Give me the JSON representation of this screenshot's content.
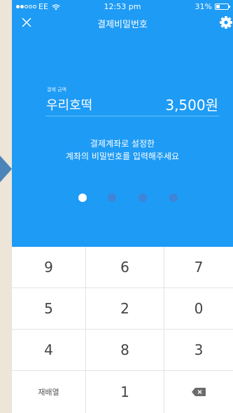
{
  "status_bar": {
    "carrier": "EE",
    "time": "12:53 pm",
    "battery": "31%",
    "signal_bars_filled": 2,
    "signal_bars_total": 5
  },
  "nav": {
    "title": "결제비밀번호",
    "close_icon": "close-icon",
    "settings_icon": "gear-icon"
  },
  "payment": {
    "amount_label": "결제 금액",
    "store_name": "우리호떡",
    "amount": "3,500원"
  },
  "instruction": {
    "line1": "결제계좌로 설정한",
    "line2": "계좌의 비밀번호를 입력해주세요"
  },
  "pin": {
    "total": 4,
    "filled": 1
  },
  "keypad": {
    "rows": [
      [
        "9",
        "6",
        "7"
      ],
      [
        "5",
        "2",
        "0"
      ],
      [
        "4",
        "8",
        "3"
      ],
      [
        "재배열",
        "1",
        "backspace"
      ]
    ],
    "backspace_icon": "backspace-icon"
  },
  "colors": {
    "primary_blue": "#1e9bf5",
    "empty_dot": "#3f84d6",
    "filled_dot": "#ffffff",
    "background": "#ece5d8",
    "side_arrow": "#4a84b8"
  }
}
